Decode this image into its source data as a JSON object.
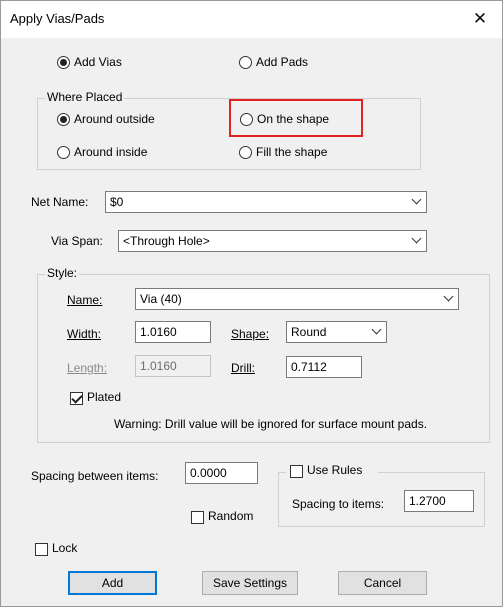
{
  "window": {
    "title": "Apply Vias/Pads",
    "close_glyph": "✕"
  },
  "mode": {
    "add_vias": "Add Vias",
    "add_pads": "Add Pads",
    "selected": "Add Vias"
  },
  "where_placed": {
    "legend": "Where Placed",
    "around_outside": "Around outside",
    "on_the_shape": "On the shape",
    "around_inside": "Around inside",
    "fill_the_shape": "Fill the shape",
    "selected": "Around outside"
  },
  "net_name": {
    "label": "Net Name:",
    "value": "$0"
  },
  "via_span": {
    "label": "Via Span:",
    "value": "<Through Hole>"
  },
  "style": {
    "legend": "Style:",
    "name_label": "Name:",
    "name_value": "Via (40)",
    "width_label": "Width:",
    "width_value": "1.0160",
    "shape_label": "Shape:",
    "shape_value": "Round",
    "length_label": "Length:",
    "length_value": "1.0160",
    "drill_label": "Drill:",
    "drill_value": "0.7112",
    "plated_label": "Plated",
    "plated_checked": true,
    "warning": "Warning: Drill value will be ignored for surface mount pads."
  },
  "spacing": {
    "between_label": "Spacing between items:",
    "between_value": "0.0000",
    "random_label": "Random",
    "use_rules_label": "Use Rules",
    "to_items_label": "Spacing to items:",
    "to_items_value": "1.2700"
  },
  "lock_label": "Lock",
  "buttons": {
    "add": "Add",
    "save_settings": "Save Settings",
    "cancel": "Cancel"
  },
  "colors": {
    "highlight": "#e32121",
    "accent": "#0078d7"
  }
}
